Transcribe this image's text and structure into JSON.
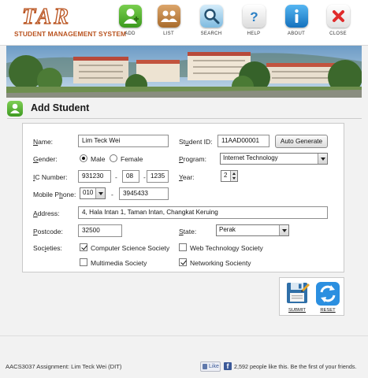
{
  "header": {
    "logo_mark": "TAR",
    "logo_text": "STUDENT MANAGEMENT SYSTEM",
    "nav": [
      {
        "label": "ADD",
        "icon": "add-user-icon"
      },
      {
        "label": "LIST",
        "icon": "users-icon"
      },
      {
        "label": "SEARCH",
        "icon": "search-icon"
      },
      {
        "label": "HELP",
        "icon": "help-icon"
      },
      {
        "label": "ABOUT",
        "icon": "info-icon"
      },
      {
        "label": "CLOSE",
        "icon": "close-icon"
      }
    ]
  },
  "page": {
    "title": "Add Student"
  },
  "form": {
    "name_label": "Name:",
    "name_value": "Lim Teck Wei",
    "student_id_label": "Student ID:",
    "student_id_value": "11AAD00001",
    "auto_generate_label": "Auto Generate",
    "gender_label": "Gender:",
    "gender_options": [
      "Male",
      "Female"
    ],
    "gender_selected": "Male",
    "program_label": "Program:",
    "program_value": "Internet Technology",
    "ic_label": "IC Number:",
    "ic_parts": [
      "931230",
      "08",
      "1235"
    ],
    "year_label": "Year:",
    "year_value": "2",
    "mobile_label": "Mobile Phone:",
    "mobile_prefix": "010",
    "mobile_number": "3945433",
    "address_label": "Address:",
    "address_value": "4, Hala Intan 1, Taman Intan, Changkat Keruing",
    "postcode_label": "Postcode:",
    "postcode_value": "32500",
    "state_label": "State:",
    "state_value": "Perak",
    "societies_label": "Societies:",
    "societies": [
      {
        "label": "Computer Science Society",
        "checked": true
      },
      {
        "label": "Web Technology Society",
        "checked": false
      },
      {
        "label": "Multimedia Society",
        "checked": false
      },
      {
        "label": "Networking Socienty",
        "checked": true
      }
    ]
  },
  "actions": {
    "submit_label": "SUBMIT",
    "reset_label": "RESET"
  },
  "footer": {
    "text": "AACS3037 Assignment: Lim Teck Wei (DIT)",
    "like_label": "Like",
    "fb_text": "2,592 people like this. Be the first of your friends."
  },
  "colors": {
    "brand": "#b9521e",
    "add": "#4aa82a",
    "list": "#c28a4a",
    "search": "#8fc7e8",
    "help": "#eeeeee",
    "about": "#1f8fd8",
    "close": "#e53030"
  }
}
